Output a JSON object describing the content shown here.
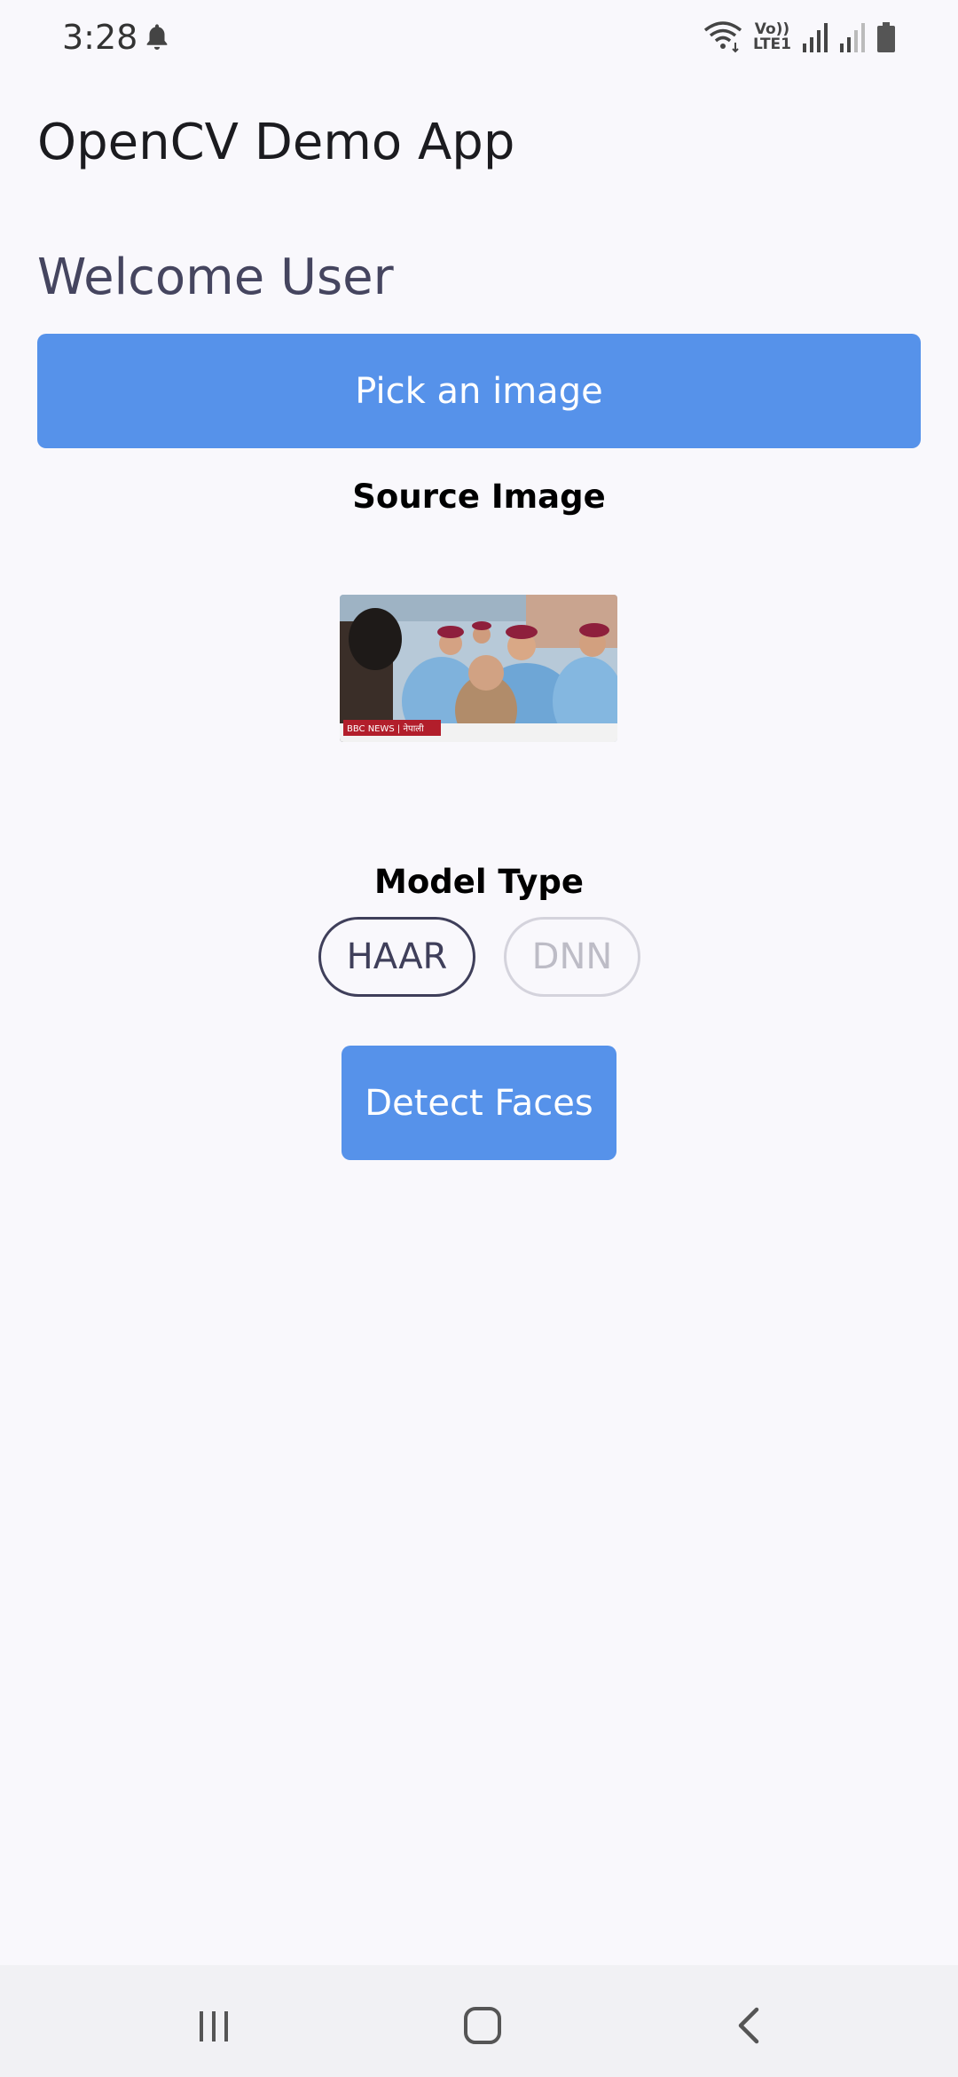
{
  "status_bar": {
    "time": "3:28",
    "volte_top": "Vo))",
    "volte_bottom": "LTE1",
    "icons": [
      "notification-bell-icon",
      "wifi-icon",
      "volte-icon",
      "signal-icon",
      "signal-icon-2",
      "battery-icon"
    ]
  },
  "app_bar": {
    "title": "OpenCV Demo App"
  },
  "main": {
    "welcome": "Welcome User",
    "pick_button_label": "Pick an image",
    "source_label": "Source Image",
    "source_image_caption": "BBC NEWS | नेपाली",
    "model_type_label": "Model Type",
    "model_options": [
      {
        "label": "HAAR",
        "selected": true
      },
      {
        "label": "DNN",
        "selected": false
      }
    ],
    "detect_button_label": "Detect Faces"
  },
  "nav_bar": {
    "icons": [
      "recents-icon",
      "home-icon",
      "back-icon"
    ]
  },
  "colors": {
    "background": "#f9f8fc",
    "button": "#5692ea",
    "chip_selected": "#3f3f5a",
    "chip_unselected": "#d4d3dc"
  }
}
